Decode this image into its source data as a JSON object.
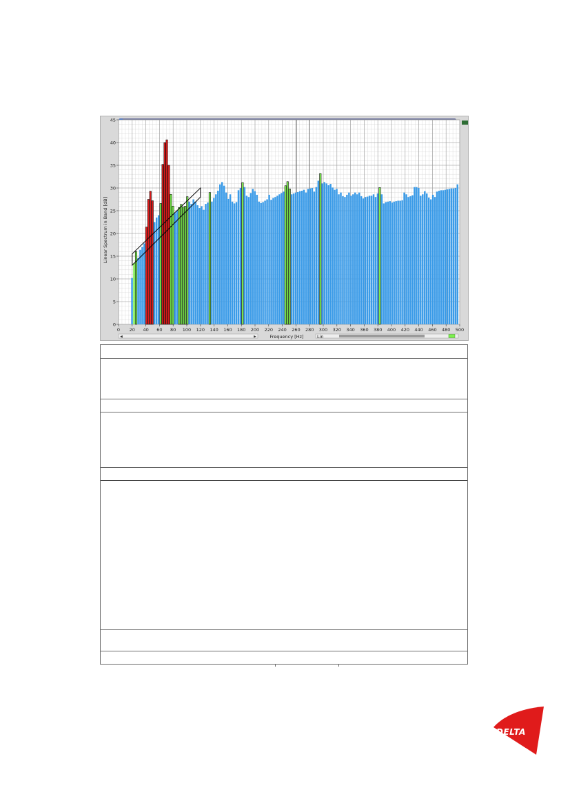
{
  "chart_data": {
    "type": "bar",
    "title": "",
    "xlabel": "Frequency [Hz]",
    "ylabel": "Linear Spectrum in Band [dB]",
    "scale_mode": "Lin",
    "xlim": [
      0,
      500
    ],
    "ylim": [
      0,
      45
    ],
    "xticks": [
      0,
      20,
      40,
      60,
      80,
      100,
      120,
      140,
      160,
      180,
      200,
      220,
      240,
      260,
      280,
      300,
      320,
      340,
      360,
      380,
      400,
      420,
      440,
      460,
      480,
      500
    ],
    "yticks": [
      0,
      5,
      10,
      15,
      20,
      25,
      30,
      35,
      40,
      45
    ],
    "grid": true,
    "bin_width_hz": 3,
    "colors": {
      "normal": "#3a9be8",
      "green": "#7cf04e",
      "red": "#e01b1b",
      "outline": "#111111"
    },
    "bars": [
      {
        "x": 20,
        "y": 10.2,
        "c": "b"
      },
      {
        "x": 23,
        "y": 13.5,
        "c": "g"
      },
      {
        "x": 26,
        "y": 16.0,
        "c": "g",
        "hi": true
      },
      {
        "x": 29,
        "y": 14.6,
        "c": "b"
      },
      {
        "x": 32,
        "y": 16.4,
        "c": "b"
      },
      {
        "x": 35,
        "y": 17.0,
        "c": "b"
      },
      {
        "x": 38,
        "y": 17.8,
        "c": "b"
      },
      {
        "x": 41,
        "y": 21.4,
        "c": "r",
        "hi": true
      },
      {
        "x": 44,
        "y": 27.5,
        "c": "r",
        "hi": true
      },
      {
        "x": 47,
        "y": 29.3,
        "c": "r",
        "hi": true
      },
      {
        "x": 50,
        "y": 27.2,
        "c": "r",
        "hi": true
      },
      {
        "x": 53,
        "y": 22.5,
        "c": "b"
      },
      {
        "x": 56,
        "y": 23.5,
        "c": "b"
      },
      {
        "x": 59,
        "y": 24.0,
        "c": "b"
      },
      {
        "x": 62,
        "y": 26.6,
        "c": "g",
        "hi": true
      },
      {
        "x": 65,
        "y": 35.2,
        "c": "r",
        "hi": true
      },
      {
        "x": 68,
        "y": 40.0,
        "c": "r",
        "hi": true
      },
      {
        "x": 71,
        "y": 40.6,
        "c": "r",
        "hi": true
      },
      {
        "x": 74,
        "y": 35.0,
        "c": "r",
        "hi": true
      },
      {
        "x": 77,
        "y": 28.6,
        "c": "g",
        "hi": true
      },
      {
        "x": 80,
        "y": 26.0,
        "c": "g",
        "hi": true
      },
      {
        "x": 83,
        "y": 24.5,
        "c": "b"
      },
      {
        "x": 86,
        "y": 25.0,
        "c": "b"
      },
      {
        "x": 89,
        "y": 25.7,
        "c": "g",
        "hi": true
      },
      {
        "x": 92,
        "y": 26.4,
        "c": "g",
        "hi": true
      },
      {
        "x": 95,
        "y": 25.8,
        "c": "g",
        "hi": true
      },
      {
        "x": 98,
        "y": 26.0,
        "c": "g",
        "hi": true
      },
      {
        "x": 101,
        "y": 28.1,
        "c": "g",
        "hi": true
      },
      {
        "x": 104,
        "y": 27.0,
        "c": "b"
      },
      {
        "x": 107,
        "y": 26.5,
        "c": "b"
      },
      {
        "x": 110,
        "y": 27.5,
        "c": "b"
      },
      {
        "x": 113,
        "y": 27.0,
        "c": "b"
      },
      {
        "x": 116,
        "y": 26.2,
        "c": "b"
      },
      {
        "x": 119,
        "y": 25.6,
        "c": "b"
      },
      {
        "x": 122,
        "y": 26.0,
        "c": "b"
      },
      {
        "x": 125,
        "y": 25.2,
        "c": "b"
      },
      {
        "x": 128,
        "y": 26.5,
        "c": "b"
      },
      {
        "x": 131,
        "y": 26.8,
        "c": "b"
      },
      {
        "x": 134,
        "y": 29.0,
        "c": "g",
        "hi": true
      },
      {
        "x": 137,
        "y": 27.0,
        "c": "b"
      },
      {
        "x": 140,
        "y": 27.8,
        "c": "b"
      },
      {
        "x": 143,
        "y": 28.6,
        "c": "b"
      },
      {
        "x": 146,
        "y": 29.4,
        "c": "b"
      },
      {
        "x": 149,
        "y": 30.8,
        "c": "b"
      },
      {
        "x": 152,
        "y": 31.3,
        "c": "b"
      },
      {
        "x": 155,
        "y": 30.5,
        "c": "b"
      },
      {
        "x": 158,
        "y": 29.0,
        "c": "b"
      },
      {
        "x": 161,
        "y": 27.6,
        "c": "b"
      },
      {
        "x": 164,
        "y": 28.6,
        "c": "b"
      },
      {
        "x": 167,
        "y": 27.0,
        "c": "b"
      },
      {
        "x": 170,
        "y": 26.6,
        "c": "b"
      },
      {
        "x": 173,
        "y": 26.9,
        "c": "b"
      },
      {
        "x": 176,
        "y": 29.5,
        "c": "b"
      },
      {
        "x": 179,
        "y": 30.0,
        "c": "b"
      },
      {
        "x": 182,
        "y": 31.2,
        "c": "g",
        "hi": true
      },
      {
        "x": 185,
        "y": 30.2,
        "c": "b"
      },
      {
        "x": 188,
        "y": 28.3,
        "c": "b"
      },
      {
        "x": 191,
        "y": 28.0,
        "c": "b"
      },
      {
        "x": 194,
        "y": 28.9,
        "c": "b"
      },
      {
        "x": 197,
        "y": 29.8,
        "c": "b"
      },
      {
        "x": 200,
        "y": 29.3,
        "c": "b"
      },
      {
        "x": 203,
        "y": 28.5,
        "c": "b"
      },
      {
        "x": 206,
        "y": 27.0,
        "c": "b"
      },
      {
        "x": 209,
        "y": 26.7,
        "c": "b"
      },
      {
        "x": 212,
        "y": 26.9,
        "c": "b"
      },
      {
        "x": 215,
        "y": 27.2,
        "c": "b"
      },
      {
        "x": 218,
        "y": 27.5,
        "c": "b"
      },
      {
        "x": 221,
        "y": 28.5,
        "c": "b"
      },
      {
        "x": 224,
        "y": 27.4,
        "c": "b"
      },
      {
        "x": 227,
        "y": 27.8,
        "c": "b"
      },
      {
        "x": 230,
        "y": 28.0,
        "c": "b"
      },
      {
        "x": 233,
        "y": 28.3,
        "c": "b"
      },
      {
        "x": 236,
        "y": 28.6,
        "c": "b"
      },
      {
        "x": 239,
        "y": 28.9,
        "c": "b"
      },
      {
        "x": 242,
        "y": 29.2,
        "c": "b"
      },
      {
        "x": 245,
        "y": 30.5,
        "c": "g",
        "hi": true
      },
      {
        "x": 248,
        "y": 31.4,
        "c": "g",
        "hi": true
      },
      {
        "x": 251,
        "y": 29.8,
        "c": "g",
        "hi": true
      },
      {
        "x": 254,
        "y": 28.6,
        "c": "b"
      },
      {
        "x": 257,
        "y": 28.8,
        "c": "b"
      },
      {
        "x": 260,
        "y": 29.0,
        "c": "b"
      },
      {
        "x": 263,
        "y": 29.1,
        "c": "b"
      },
      {
        "x": 266,
        "y": 29.3,
        "c": "b"
      },
      {
        "x": 269,
        "y": 29.4,
        "c": "b"
      },
      {
        "x": 272,
        "y": 29.6,
        "c": "b"
      },
      {
        "x": 275,
        "y": 29.0,
        "c": "b"
      },
      {
        "x": 278,
        "y": 29.8,
        "c": "b"
      },
      {
        "x": 281,
        "y": 29.9,
        "c": "b"
      },
      {
        "x": 284,
        "y": 30.0,
        "c": "b"
      },
      {
        "x": 287,
        "y": 29.2,
        "c": "b"
      },
      {
        "x": 290,
        "y": 30.2,
        "c": "b"
      },
      {
        "x": 293,
        "y": 31.6,
        "c": "b"
      },
      {
        "x": 296,
        "y": 33.2,
        "c": "g",
        "hi": true
      },
      {
        "x": 299,
        "y": 31.0,
        "c": "b"
      },
      {
        "x": 302,
        "y": 31.3,
        "c": "b"
      },
      {
        "x": 305,
        "y": 31.0,
        "c": "b"
      },
      {
        "x": 308,
        "y": 30.6,
        "c": "b"
      },
      {
        "x": 311,
        "y": 30.9,
        "c": "b"
      },
      {
        "x": 314,
        "y": 30.1,
        "c": "b"
      },
      {
        "x": 317,
        "y": 29.6,
        "c": "b"
      },
      {
        "x": 320,
        "y": 29.8,
        "c": "b"
      },
      {
        "x": 323,
        "y": 28.6,
        "c": "b"
      },
      {
        "x": 326,
        "y": 29.0,
        "c": "b"
      },
      {
        "x": 329,
        "y": 28.2,
        "c": "b"
      },
      {
        "x": 332,
        "y": 28.0,
        "c": "b"
      },
      {
        "x": 335,
        "y": 28.5,
        "c": "b"
      },
      {
        "x": 338,
        "y": 29.0,
        "c": "b"
      },
      {
        "x": 341,
        "y": 28.3,
        "c": "b"
      },
      {
        "x": 344,
        "y": 28.6,
        "c": "b"
      },
      {
        "x": 347,
        "y": 29.0,
        "c": "b"
      },
      {
        "x": 350,
        "y": 28.6,
        "c": "b"
      },
      {
        "x": 353,
        "y": 29.0,
        "c": "b"
      },
      {
        "x": 356,
        "y": 28.2,
        "c": "b"
      },
      {
        "x": 359,
        "y": 27.7,
        "c": "b"
      },
      {
        "x": 362,
        "y": 28.0,
        "c": "b"
      },
      {
        "x": 365,
        "y": 28.1,
        "c": "b"
      },
      {
        "x": 368,
        "y": 28.3,
        "c": "b"
      },
      {
        "x": 371,
        "y": 28.3,
        "c": "b"
      },
      {
        "x": 374,
        "y": 28.6,
        "c": "b"
      },
      {
        "x": 377,
        "y": 28.0,
        "c": "b"
      },
      {
        "x": 380,
        "y": 28.8,
        "c": "b"
      },
      {
        "x": 383,
        "y": 30.1,
        "c": "g",
        "hi": true
      },
      {
        "x": 386,
        "y": 28.6,
        "c": "b"
      },
      {
        "x": 389,
        "y": 26.6,
        "c": "b"
      },
      {
        "x": 392,
        "y": 26.9,
        "c": "b"
      },
      {
        "x": 395,
        "y": 27.0,
        "c": "b"
      },
      {
        "x": 398,
        "y": 27.1,
        "c": "b"
      },
      {
        "x": 401,
        "y": 26.8,
        "c": "b"
      },
      {
        "x": 404,
        "y": 27.0,
        "c": "b"
      },
      {
        "x": 407,
        "y": 27.1,
        "c": "b"
      },
      {
        "x": 410,
        "y": 27.2,
        "c": "b"
      },
      {
        "x": 413,
        "y": 27.2,
        "c": "b"
      },
      {
        "x": 416,
        "y": 27.3,
        "c": "b"
      },
      {
        "x": 419,
        "y": 29.0,
        "c": "b"
      },
      {
        "x": 422,
        "y": 28.6,
        "c": "b"
      },
      {
        "x": 425,
        "y": 28.0,
        "c": "b"
      },
      {
        "x": 428,
        "y": 28.2,
        "c": "b"
      },
      {
        "x": 431,
        "y": 28.4,
        "c": "b"
      },
      {
        "x": 434,
        "y": 30.2,
        "c": "b"
      },
      {
        "x": 437,
        "y": 30.2,
        "c": "b"
      },
      {
        "x": 440,
        "y": 30.0,
        "c": "b"
      },
      {
        "x": 443,
        "y": 28.3,
        "c": "b"
      },
      {
        "x": 446,
        "y": 28.6,
        "c": "b"
      },
      {
        "x": 449,
        "y": 29.3,
        "c": "b"
      },
      {
        "x": 452,
        "y": 28.8,
        "c": "b"
      },
      {
        "x": 455,
        "y": 27.9,
        "c": "b"
      },
      {
        "x": 458,
        "y": 27.5,
        "c": "b"
      },
      {
        "x": 461,
        "y": 28.5,
        "c": "b"
      },
      {
        "x": 464,
        "y": 28.0,
        "c": "b"
      },
      {
        "x": 467,
        "y": 29.2,
        "c": "b"
      },
      {
        "x": 470,
        "y": 29.4,
        "c": "b"
      },
      {
        "x": 473,
        "y": 29.5,
        "c": "b"
      },
      {
        "x": 476,
        "y": 29.5,
        "c": "b"
      },
      {
        "x": 479,
        "y": 29.6,
        "c": "b"
      },
      {
        "x": 482,
        "y": 29.7,
        "c": "b"
      },
      {
        "x": 485,
        "y": 29.8,
        "c": "b"
      },
      {
        "x": 488,
        "y": 29.9,
        "c": "b"
      },
      {
        "x": 491,
        "y": 29.9,
        "c": "b"
      },
      {
        "x": 494,
        "y": 30.0,
        "c": "b"
      },
      {
        "x": 497,
        "y": 30.8,
        "c": "b"
      }
    ],
    "annotation_band": {
      "x1": 20,
      "y1_low": 13.0,
      "y1_high": 15.5,
      "x2": 120,
      "y2_low": 28.0,
      "y2_high": 30.0
    }
  },
  "logo": {
    "text": "DELTA",
    "color": "#e01b1b"
  }
}
